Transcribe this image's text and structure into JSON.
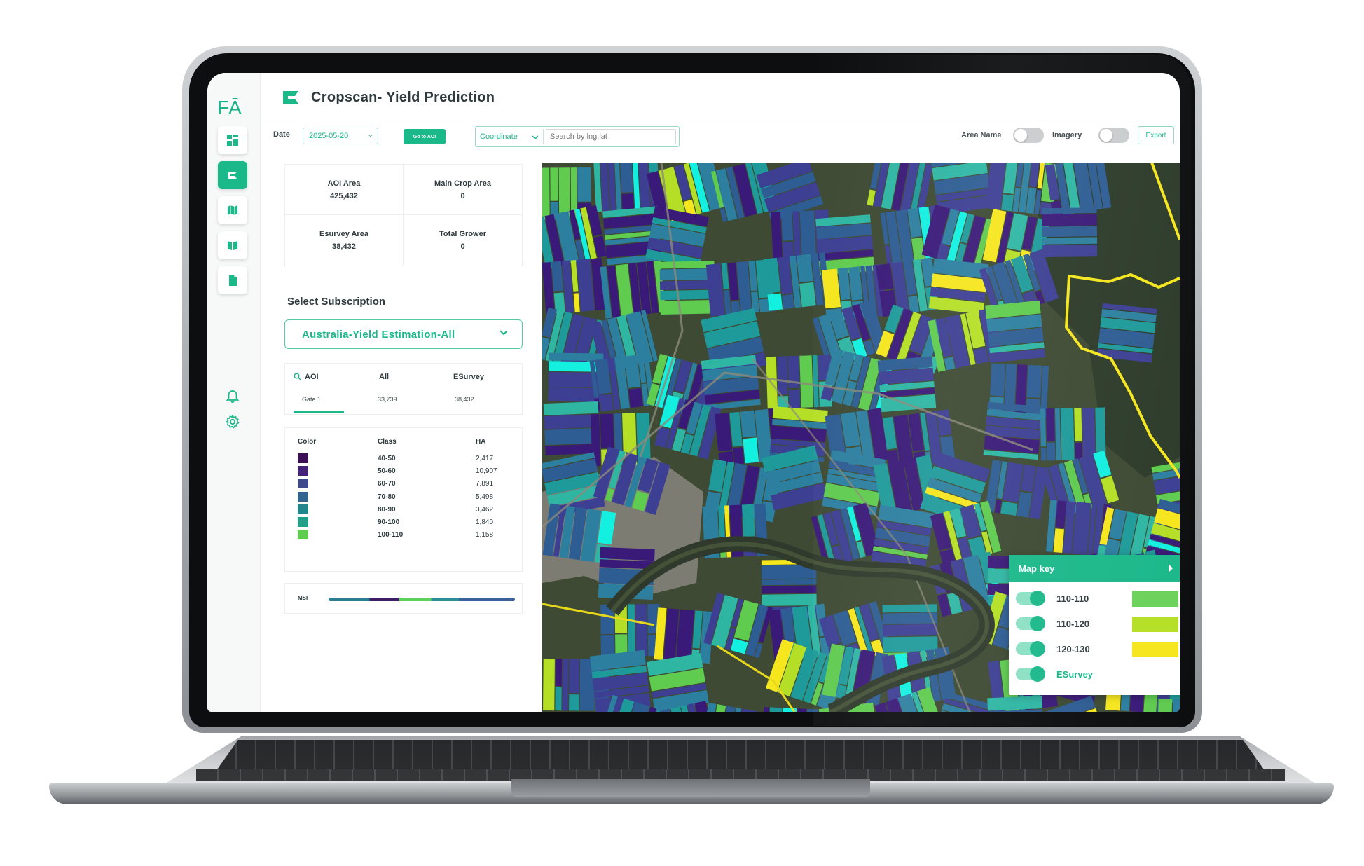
{
  "app": {
    "logo": "FĀ",
    "title": "Cropscan- Yield Prediction"
  },
  "toolbar": {
    "date_label": "Date",
    "date_value": "2025-05-20",
    "goto_label": "Go to AOI",
    "coord_select": "Coordinate",
    "search_placeholder": "Search by lng,lat",
    "area_name_label": "Area Name",
    "imagery_label": "Imagery",
    "export_label": "Export"
  },
  "stats": {
    "aoi_area_label": "AOI Area",
    "aoi_area_value": "425,432",
    "main_crop_label": "Main Crop Area",
    "main_crop_value": "0",
    "esurvey_label": "Esurvey Area",
    "esurvey_value": "38,432",
    "total_grower_label": "Total Grower",
    "total_grower_value": "0"
  },
  "subscription": {
    "title": "Select Subscription",
    "selected": "Australia-Yield Estimation-All"
  },
  "aoi_table": {
    "headers": [
      "AOI",
      "All",
      "ESurvey"
    ],
    "row": [
      "Gate 1",
      "33,739",
      "38,432"
    ]
  },
  "legend": {
    "headers": [
      "Color",
      "Class",
      "HA"
    ],
    "rows": [
      {
        "color": "#3d0f55",
        "class": "40-50",
        "ha": "2,417"
      },
      {
        "color": "#45237a",
        "class": "50-60",
        "ha": "10,907"
      },
      {
        "color": "#3e4a8a",
        "class": "60-70",
        "ha": "7,891"
      },
      {
        "color": "#31648e",
        "class": "70-80",
        "ha": "5,498"
      },
      {
        "color": "#22868c",
        "class": "80-90",
        "ha": "3,462"
      },
      {
        "color": "#21a087",
        "class": "90-100",
        "ha": "1,840"
      },
      {
        "color": "#5fcb4f",
        "class": "100-110",
        "ha": "1,158"
      }
    ],
    "msf_label": "MSF"
  },
  "map_key": {
    "title": "Map key",
    "items": [
      {
        "label": "110-110",
        "color": "#6bd25a"
      },
      {
        "label": "110-120",
        "color": "#b5df26"
      },
      {
        "label": "120-130",
        "color": "#f5e61e"
      },
      {
        "label": "ESurvey",
        "color": ""
      }
    ]
  },
  "colors": {
    "accent": "#1bb88a",
    "map_palette": [
      "#3a1a78",
      "#3d3f93",
      "#2e5d93",
      "#2d7fa0",
      "#1f9a9a",
      "#2fb6a3",
      "#5fcb4f",
      "#b5df26",
      "#f5e61e",
      "#13f0e0"
    ]
  }
}
